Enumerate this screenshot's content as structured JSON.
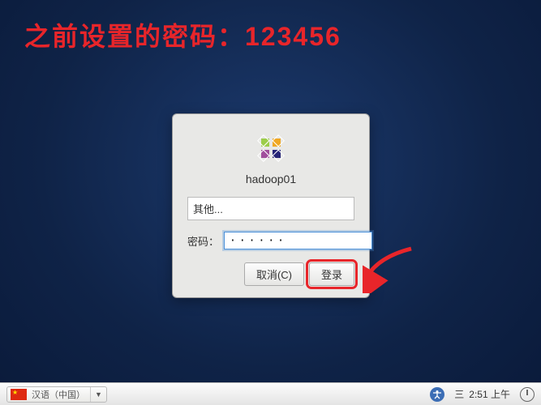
{
  "annotation": "之前设置的密码：123456",
  "login": {
    "hostname": "hadoop01",
    "username_display": "其他...",
    "password_label": "密码：",
    "password_value": "······",
    "cancel_label": "取消(C)",
    "login_label": "登录"
  },
  "taskbar": {
    "ime_label": "汉语（中国）",
    "day": "三",
    "time": "2:51 上午"
  }
}
